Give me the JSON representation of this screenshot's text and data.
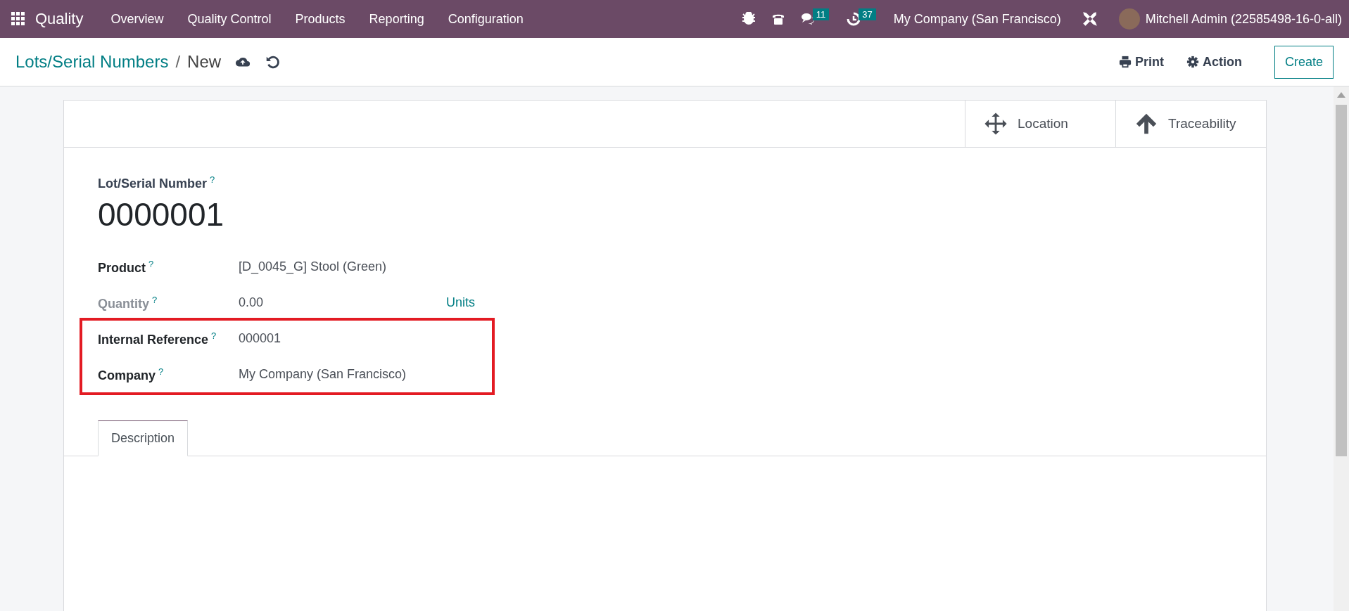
{
  "navbar": {
    "app_name": "Quality",
    "menu": [
      "Overview",
      "Quality Control",
      "Products",
      "Reporting",
      "Configuration"
    ],
    "systray": [
      {
        "kind": "bug"
      },
      {
        "kind": "phone"
      },
      {
        "kind": "chat",
        "badge": "11"
      },
      {
        "kind": "clock",
        "badge": "37"
      }
    ],
    "company": "My Company (San Francisco)",
    "user": "Mitchell Admin (22585498-16-0-all)"
  },
  "control_panel": {
    "breadcrumb": "Lots/Serial Numbers",
    "separator": "/",
    "current": "New",
    "print": "Print",
    "action": "Action",
    "create": "Create"
  },
  "smart_buttons": [
    {
      "kind": "move",
      "label": "Location"
    },
    {
      "kind": "up",
      "label": "Traceability"
    }
  ],
  "form": {
    "title_label": "Lot/Serial Number",
    "title_help": "?",
    "title": "0000001",
    "fields": [
      {
        "label": "Product",
        "help": "?",
        "value": "[D_0045_G] Stool (Green)",
        "muted": false,
        "highlighted": false
      },
      {
        "label": "Quantity",
        "help": "?",
        "value": "0.00",
        "unit": "Units",
        "muted": true,
        "highlighted": false
      },
      {
        "label": "Internal Reference",
        "help": "?",
        "value": "000001",
        "muted": false,
        "highlighted": true
      },
      {
        "label": "Company",
        "help": "?",
        "value": "My Company (San Francisco)",
        "muted": false,
        "highlighted": true
      }
    ],
    "tabs": [
      {
        "label": "Description",
        "selected": true
      }
    ]
  }
}
